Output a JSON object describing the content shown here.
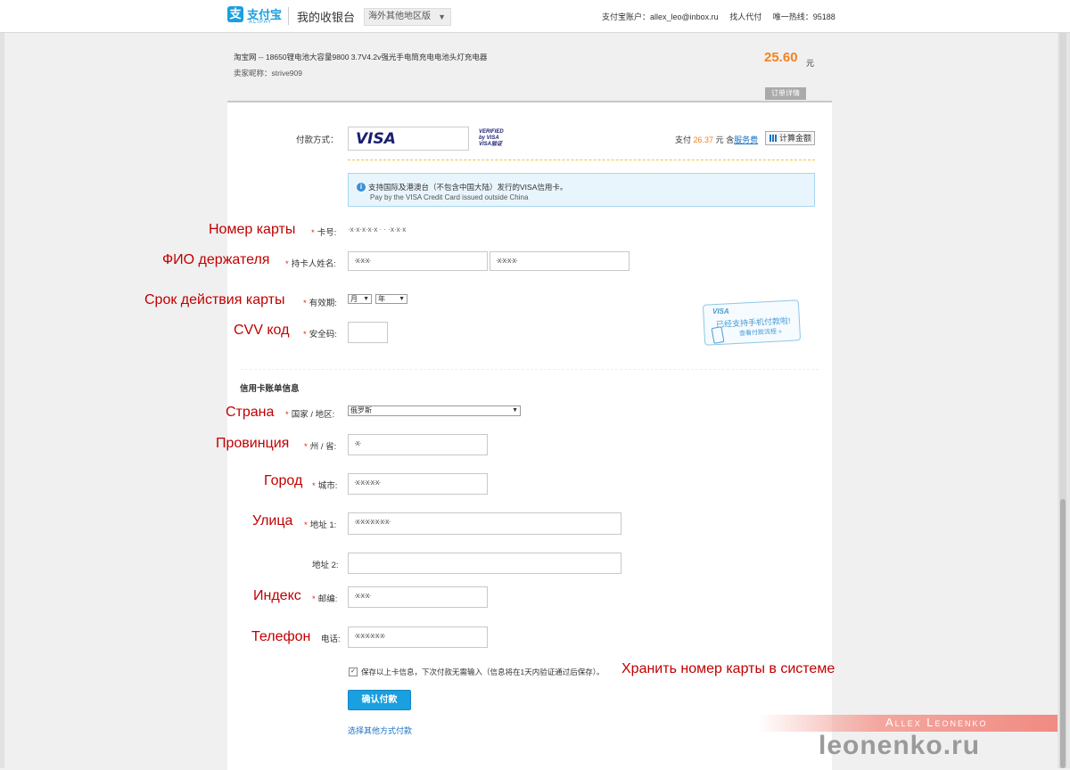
{
  "header": {
    "logo_glyph": "支",
    "logo_cn": "支付宝",
    "logo_en": "ALIPAY",
    "cashier_title": "我的收银台",
    "region_label": "海外其他地区版",
    "account_label": "支付宝账户：allex_leo@inbox.ru",
    "proxy_pay": "找人代付",
    "hotline": "唯一热线：95188"
  },
  "order": {
    "title": "淘宝网 -- 18650锂电池大容量9800 3.7V4.2v强光手电筒充电电池头灯充电器",
    "seller": "卖家昵称：strive909",
    "amount": "25.60",
    "currency": "元",
    "detail_button": "订单详情"
  },
  "payment": {
    "method_label": "付款方式：",
    "card_brand": "VISA",
    "vbv_line1": "VERIFIED",
    "vbv_line2": "by VISA",
    "vbv_line3": "VISA验证",
    "summary_prefix": "支付",
    "summary_amount": "26.37",
    "summary_mid": "元 含",
    "summary_fee_link": "服务费",
    "calc_button": "计算金额",
    "notice_cn": "支持国际及港澳台（不包含中国大陆）发行的VISA信用卡。",
    "notice_en": "Pay by the VISA Credit Card issued outside China"
  },
  "card_form": {
    "card_number_label": "卡号:",
    "card_number_value": "·x·x·x·x·x   ·  ·  ·x·x·x",
    "holder_label": "持卡人姓名:",
    "holder_first": "·x·x·x·",
    "holder_last": "·x·x·x·x·",
    "expiry_label": "有效期:",
    "month_placeholder": "月",
    "year_placeholder": "年",
    "cvv_label": "安全码:"
  },
  "promo": {
    "brand": "VISA",
    "line1": "已经支持手机付款啦!",
    "line2": "查看付款流程 »"
  },
  "billing": {
    "section_title": "信用卡账单信息",
    "country_label": "国家 / 地区:",
    "country_value": "俄罗斯",
    "province_label": "州 / 省:",
    "province_value": "·x·",
    "city_label": "城市:",
    "city_value": "·x·x·x·x·x·",
    "address1_label": "地址 1:",
    "address1_value": "·x·x·x·x·x·x·x·",
    "address2_label": "地址 2:",
    "address2_value": "",
    "zip_label": "邮编:",
    "zip_value": "·x·x·x·",
    "phone_label": "电话:",
    "phone_value": "·x·x·x·x·x·x·"
  },
  "actions": {
    "checkbox_mark": "✓",
    "save_card_label": "保存以上卡信息，下次付款无需输入（信息将在1天内验证通过后保存）。",
    "confirm_button": "确认付款",
    "other_method_link": "选择其他方式付款"
  },
  "annotations": {
    "card_number": "Номер карты",
    "holder_name": "ФИО держателя",
    "expiry": "Срок действия карты",
    "cvv": "CVV код",
    "country": "Страна",
    "province": "Провинция",
    "city": "Город",
    "street": "Улица",
    "zip": "Индекс",
    "phone": "Телефон",
    "save_card": "Хранить номер карты в системе"
  },
  "watermark": {
    "author": "Allex Leonenko",
    "site": "leonenko.ru"
  },
  "colors": {
    "alipay_blue": "#1a9fe0",
    "amount_orange": "#f58220",
    "annotation_red": "#c00000",
    "required_red": "#e1251b"
  },
  "icons": [
    "alipay-logo-icon",
    "dropdown-arrow-icon",
    "info-icon",
    "calculator-icon",
    "checkbox-icon",
    "phone-icon"
  ]
}
